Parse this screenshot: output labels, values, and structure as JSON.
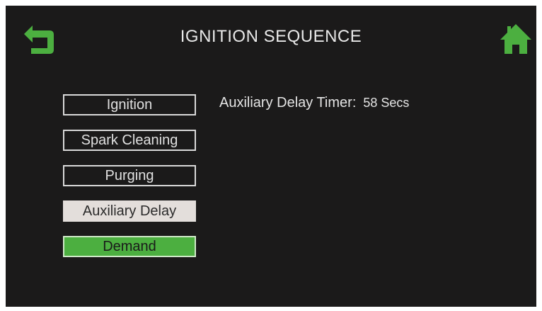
{
  "screen": {
    "title": "IGNITION SEQUENCE"
  },
  "nav": {
    "back_icon": "back-arrow-icon",
    "home_icon": "home-icon",
    "accent_color": "#4caf40"
  },
  "menu": {
    "items": [
      {
        "label": "Ignition",
        "state": "normal"
      },
      {
        "label": "Spark Cleaning",
        "state": "normal"
      },
      {
        "label": "Purging",
        "state": "normal"
      },
      {
        "label": "Auxiliary Delay",
        "state": "selected"
      },
      {
        "label": "Demand",
        "state": "active"
      }
    ]
  },
  "detail": {
    "label": "Auxiliary Delay Timer:",
    "value": "58 Secs"
  }
}
